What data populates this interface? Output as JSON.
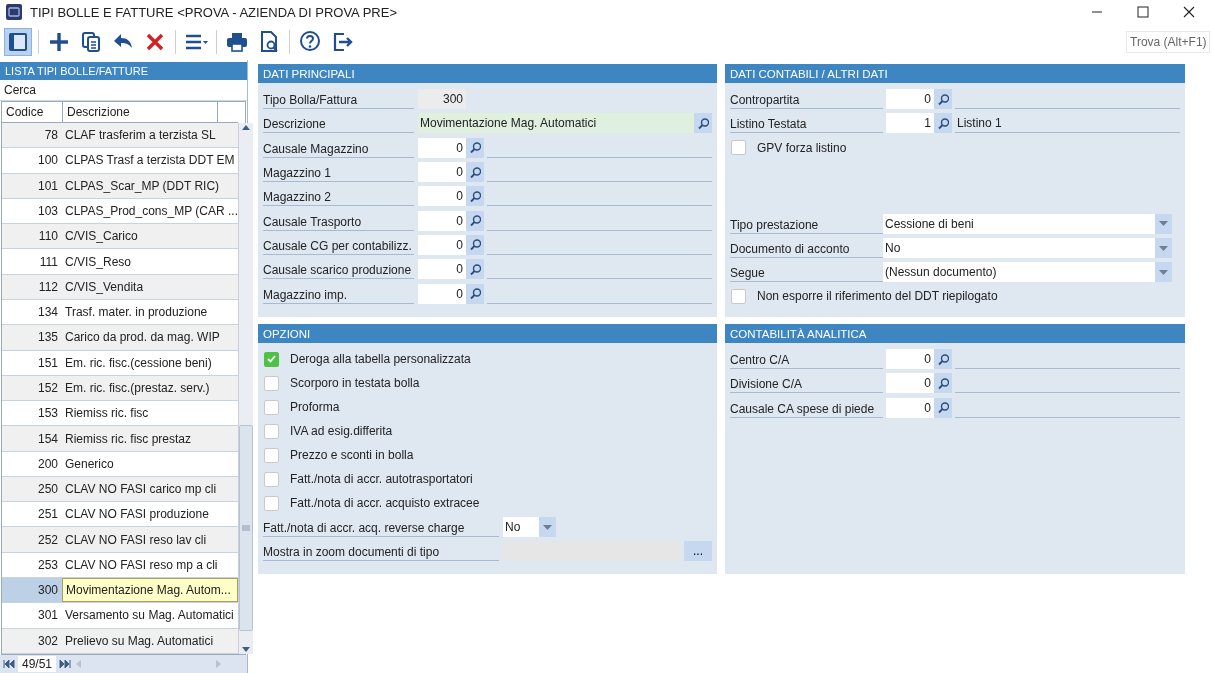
{
  "window": {
    "title": "TIPI BOLLE E FATTURE <PROVA - AZIENDA DI PROVA PRE>"
  },
  "toolbar": {
    "groups": [
      [
        {
          "kind": "sidebar",
          "selected": true
        }
      ],
      [
        {
          "kind": "add",
          "selected": false
        },
        {
          "kind": "copy",
          "selected": false
        },
        {
          "kind": "undo",
          "selected": false
        },
        {
          "kind": "delete",
          "selected": false
        }
      ],
      [
        {
          "kind": "menu",
          "selected": false
        }
      ],
      [
        {
          "kind": "print",
          "selected": false
        },
        {
          "kind": "preview",
          "selected": false
        }
      ],
      [
        {
          "kind": "help",
          "selected": false
        },
        {
          "kind": "exit",
          "selected": false
        }
      ]
    ],
    "search": {
      "placeholder": "Trova (Alt+F1)"
    }
  },
  "list": {
    "title": "LISTA TIPI BOLLE/FATTURE",
    "search_label": "Cerca",
    "columns": [
      "Codice",
      "Descrizione"
    ],
    "rows": [
      {
        "code": "78",
        "description": "CLAF trasferim a terzista SL",
        "selected": false
      },
      {
        "code": "100",
        "description": "CLPAS Trasf a terzista DDT EM",
        "selected": false
      },
      {
        "code": "101",
        "description": "CLPAS_Scar_MP (DDT RIC)",
        "selected": false
      },
      {
        "code": "103",
        "description": "CLPAS_Prod_cons_MP (CAR ...",
        "selected": false
      },
      {
        "code": "110",
        "description": "C/VIS_Carico",
        "selected": false
      },
      {
        "code": "111",
        "description": "C/VIS_Reso",
        "selected": false
      },
      {
        "code": "112",
        "description": "C/VIS_Vendita",
        "selected": false
      },
      {
        "code": "134",
        "description": "Trasf. mater.  in produzione",
        "selected": false
      },
      {
        "code": "135",
        "description": "Carico da prod. da mag. WIP",
        "selected": false
      },
      {
        "code": "151",
        "description": "Em. ric. fisc.(cessione beni)",
        "selected": false
      },
      {
        "code": "152",
        "description": "Em. ric. fisc.(prestaz. serv.)",
        "selected": false
      },
      {
        "code": "153",
        "description": "Riemiss ric. fisc",
        "selected": false
      },
      {
        "code": "154",
        "description": "Riemiss ric. fisc prestaz",
        "selected": false
      },
      {
        "code": "200",
        "description": "Generico",
        "selected": false
      },
      {
        "code": "250",
        "description": "CLAV NO FASI carico mp cli",
        "selected": false
      },
      {
        "code": "251",
        "description": "CLAV NO FASI produzione",
        "selected": false
      },
      {
        "code": "252",
        "description": "CLAV NO FASI reso lav cli",
        "selected": false
      },
      {
        "code": "253",
        "description": "CLAV NO FASI reso mp a cli",
        "selected": false
      },
      {
        "code": "300",
        "description": "Movimentazione Mag. Autom...",
        "selected": true
      },
      {
        "code": "301",
        "description": "Versamento su Mag. Automatici",
        "selected": false
      },
      {
        "code": "302",
        "description": "Prelievo su Mag. Automatici",
        "selected": false
      }
    ],
    "pager": "49/51"
  },
  "dati_principali": {
    "title": "DATI PRINCIPALI",
    "fields": [
      {
        "kind": "readonly",
        "label": "Tipo Bolla/Fattura",
        "value": "300"
      },
      {
        "kind": "description",
        "label": "Descrizione",
        "value": "Movimentazione Mag. Automatici"
      },
      {
        "kind": "lookup",
        "label": "Causale Magazzino",
        "value": "0"
      },
      {
        "kind": "lookup",
        "label": "Magazzino 1",
        "value": "0"
      },
      {
        "kind": "lookup",
        "label": "Magazzino 2",
        "value": "0"
      },
      {
        "kind": "lookup",
        "label": "Causale Trasporto",
        "value": "0"
      },
      {
        "kind": "lookup",
        "label": "Causale CG per contabilizz.",
        "value": "0"
      },
      {
        "kind": "lookup",
        "label": "Causale scarico produzione",
        "value": "0"
      },
      {
        "kind": "lookup",
        "label": "Magazzino imp.",
        "value": "0"
      }
    ]
  },
  "opzioni": {
    "title": "OPZIONI",
    "fields": [
      {
        "kind": "checkbox",
        "label": "Deroga alla tabella personalizzata",
        "checked": true
      },
      {
        "kind": "checkbox",
        "label": "Scorporo in testata bolla",
        "checked": false
      },
      {
        "kind": "checkbox",
        "label": "Proforma",
        "checked": false
      },
      {
        "kind": "checkbox",
        "label": "IVA ad esig.differita",
        "checked": false
      },
      {
        "kind": "checkbox",
        "label": "Prezzo e sconti in bolla",
        "checked": false
      },
      {
        "kind": "checkbox",
        "label": "Fatt./nota di accr. autotrasportatori",
        "checked": false
      },
      {
        "kind": "checkbox",
        "label": "Fatt./nota di accr. acquisto extracee",
        "checked": false
      },
      {
        "kind": "small_combo",
        "label": "Fatt./nota di accr. acq. reverse charge",
        "value": "No"
      },
      {
        "kind": "browse",
        "label": "Mostra in zoom documenti di tipo",
        "button": "..."
      }
    ]
  },
  "dati_contabili": {
    "title": "DATI CONTABILI / ALTRI DATI",
    "fields": [
      {
        "kind": "lookup",
        "label": "Contropartita",
        "value": "0"
      },
      {
        "kind": "lookup",
        "label": "Listino Testata",
        "value": "1",
        "detail": "Listino 1"
      },
      {
        "kind": "checkbox",
        "label": "GPV forza listino",
        "checked": false
      }
    ],
    "lower_fields": [
      {
        "kind": "combo",
        "label": "Tipo prestazione",
        "value": "Cessione di beni"
      },
      {
        "kind": "combo",
        "label": "Documento di acconto",
        "value": "No"
      },
      {
        "kind": "combo",
        "label": "Segue",
        "value": "(Nessun documento)"
      },
      {
        "kind": "checkbox",
        "label": "Non esporre il riferimento del DDT riepilogato",
        "checked": false
      }
    ]
  },
  "contabilita_analitica": {
    "title": "CONTABILITÀ ANALITICA",
    "fields": [
      {
        "kind": "lookup",
        "label": "Centro C/A",
        "value": "0"
      },
      {
        "kind": "lookup",
        "label": "Divisione C/A",
        "value": "0"
      },
      {
        "kind": "lookup",
        "label": "Causale CA spese di piede",
        "value": "0"
      }
    ]
  }
}
